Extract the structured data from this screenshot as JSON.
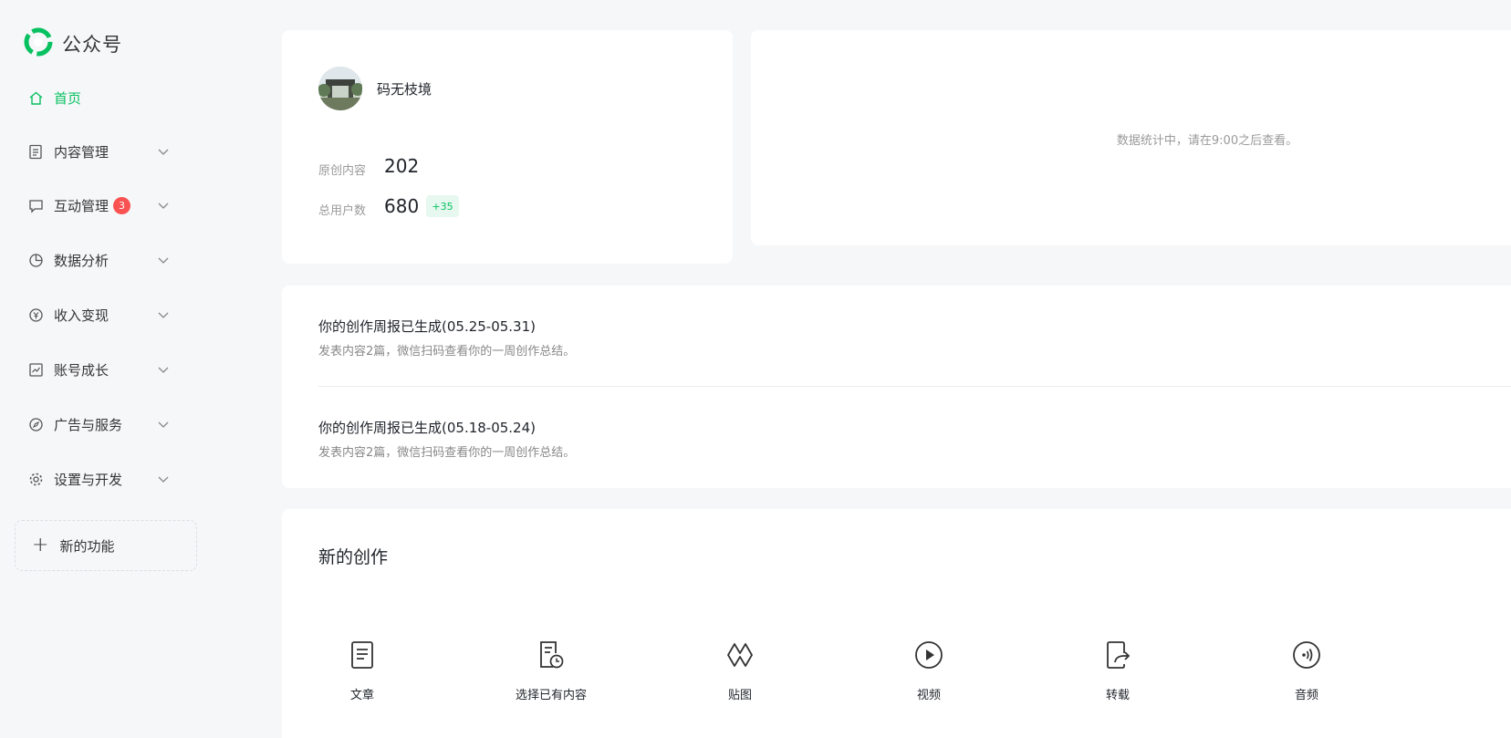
{
  "app": {
    "title": "公众号",
    "brand_color": "#07c160"
  },
  "sidebar": {
    "items": [
      {
        "label": "首页",
        "icon": "home-icon",
        "active": true
      },
      {
        "label": "内容管理",
        "icon": "document-icon"
      },
      {
        "label": "互动管理",
        "icon": "message-icon",
        "badge": "3"
      },
      {
        "label": "数据分析",
        "icon": "pie-chart-icon"
      },
      {
        "label": "收入变现",
        "icon": "yen-icon"
      },
      {
        "label": "账号成长",
        "icon": "growth-chart-icon"
      },
      {
        "label": "广告与服务",
        "icon": "compass-icon"
      },
      {
        "label": "设置与开发",
        "icon": "gear-icon"
      }
    ],
    "new_features": {
      "label": "新的功能",
      "icon": "plus-icon"
    }
  },
  "profile": {
    "name": "码无枝境",
    "stats": [
      {
        "label": "原创内容",
        "value": "202"
      },
      {
        "label": "总用户数",
        "value": "680",
        "delta": "+35"
      }
    ]
  },
  "data_panel": {
    "note": "数据统计中，请在9:00之后查看。"
  },
  "reports": [
    {
      "title": "你的创作周报已生成(05.25-05.31)",
      "subtitle": "发表内容2篇，微信扫码查看你的一周创作总结。"
    },
    {
      "title": "你的创作周报已生成(05.18-05.24)",
      "subtitle": "发表内容2篇，微信扫码查看你的一周创作总结。"
    }
  ],
  "create": {
    "title": "新的创作",
    "tools": [
      {
        "label": "文章",
        "icon": "article-icon"
      },
      {
        "label": "选择已有内容",
        "icon": "existing-content-icon"
      },
      {
        "label": "贴图",
        "icon": "image-post-icon"
      },
      {
        "label": "视频",
        "icon": "video-play-icon"
      },
      {
        "label": "转载",
        "icon": "repost-icon"
      },
      {
        "label": "音频",
        "icon": "audio-icon"
      }
    ]
  }
}
